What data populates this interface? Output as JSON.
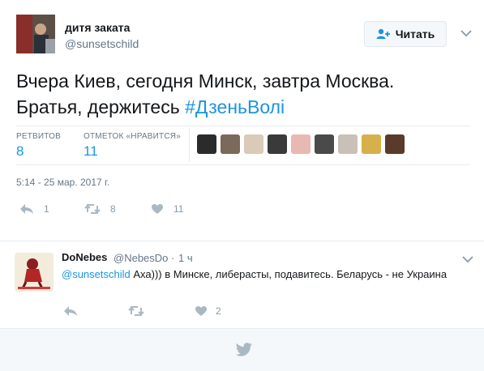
{
  "tweet": {
    "author_name": "дитя заката",
    "author_handle": "@sunsetschild",
    "follow_label": "Читать",
    "text_line1": "Вчера Киев, сегодня Минск, завтра Москва.",
    "text_line2": "Братья, держитесь ",
    "hashtag": "#ДзеньВолі",
    "stats": {
      "retweets_label": "РЕТВИТОВ",
      "retweets": "8",
      "likes_label": "ОТМЕТОК «НРАВИТСЯ»",
      "likes": "11"
    },
    "timestamp": "5:14 - 25 мар. 2017 г.",
    "actions": {
      "reply_count": "1",
      "retweet_count": "8",
      "like_count": "11"
    }
  },
  "likers": [
    {
      "color": "#2b2b2b"
    },
    {
      "color": "#7a6a5a"
    },
    {
      "color": "#d9cbb8"
    },
    {
      "color": "#3a3a3a"
    },
    {
      "color": "#e8b9b2"
    },
    {
      "color": "#4a4a4a"
    },
    {
      "color": "#c9c0b7"
    },
    {
      "color": "#d6b04a"
    },
    {
      "color": "#5a3a2a"
    }
  ],
  "reply": {
    "author_name": "DoNebes",
    "author_handle": "@NebesDo",
    "separator": "·",
    "time": "1 ч",
    "mention": "@sunsetschild",
    "text": " Аха))) в Минске, либерасты, подавитесь. Беларусь - не Украина",
    "actions": {
      "like_count": "2"
    }
  },
  "colors": {
    "accent": "#1b95e0",
    "muted": "#657786",
    "icon": "#8899a6"
  },
  "icons": [
    "person-add-icon",
    "chevron-down-icon",
    "reply-icon",
    "retweet-icon",
    "heart-icon",
    "twitter-bird-icon"
  ]
}
